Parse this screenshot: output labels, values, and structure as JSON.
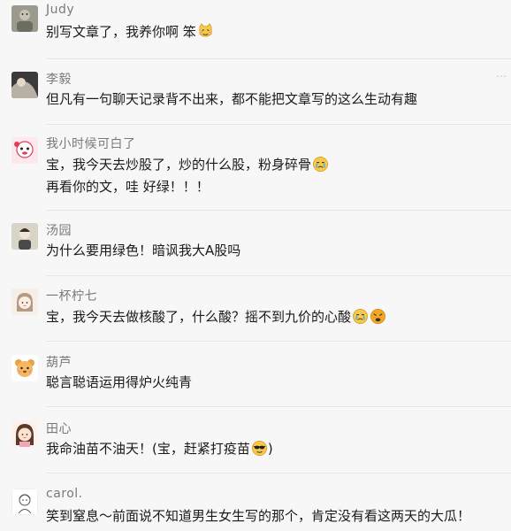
{
  "comments": [
    {
      "name": "Judy",
      "lines": [
        "别写文章了，我养你啊 笨"
      ],
      "emojis": [
        "cat-face"
      ]
    },
    {
      "name": "李毅",
      "lines": [
        "但凡有一句聊天记录背不出来，都不能把文章写的这么生动有趣"
      ],
      "emojis": []
    },
    {
      "name": "我小时候可白了",
      "lines": [
        "宝，我今天去炒股了，炒的什么股，粉身碎骨",
        "再看你的文，哇 好绿！！！"
      ],
      "emojis": [
        "crying-face"
      ]
    },
    {
      "name": "汤园",
      "lines": [
        "为什么要用绿色！暗讽我大A股吗"
      ],
      "emojis": []
    },
    {
      "name": "一杯柠七",
      "lines": [
        "宝，我今天去做核酸了，什么酸？摇不到九价的心酸"
      ],
      "emojis": [
        "crying-face",
        "weary-face"
      ]
    },
    {
      "name": "葫芦",
      "lines": [
        "聪言聪语运用得炉火纯青"
      ],
      "emojis": []
    },
    {
      "name": "田心",
      "lines": [
        "我命油苗不油天！(宝，赶紧打疫苗",
        ")"
      ],
      "emojis": [
        "sunglasses-face"
      ]
    },
    {
      "name": "carol.",
      "lines": [
        "笑到窒息～前面说不知道男生女生写的那个，肯定没有看这两天的大瓜！"
      ],
      "emojis": []
    }
  ],
  "more_icon": "…"
}
